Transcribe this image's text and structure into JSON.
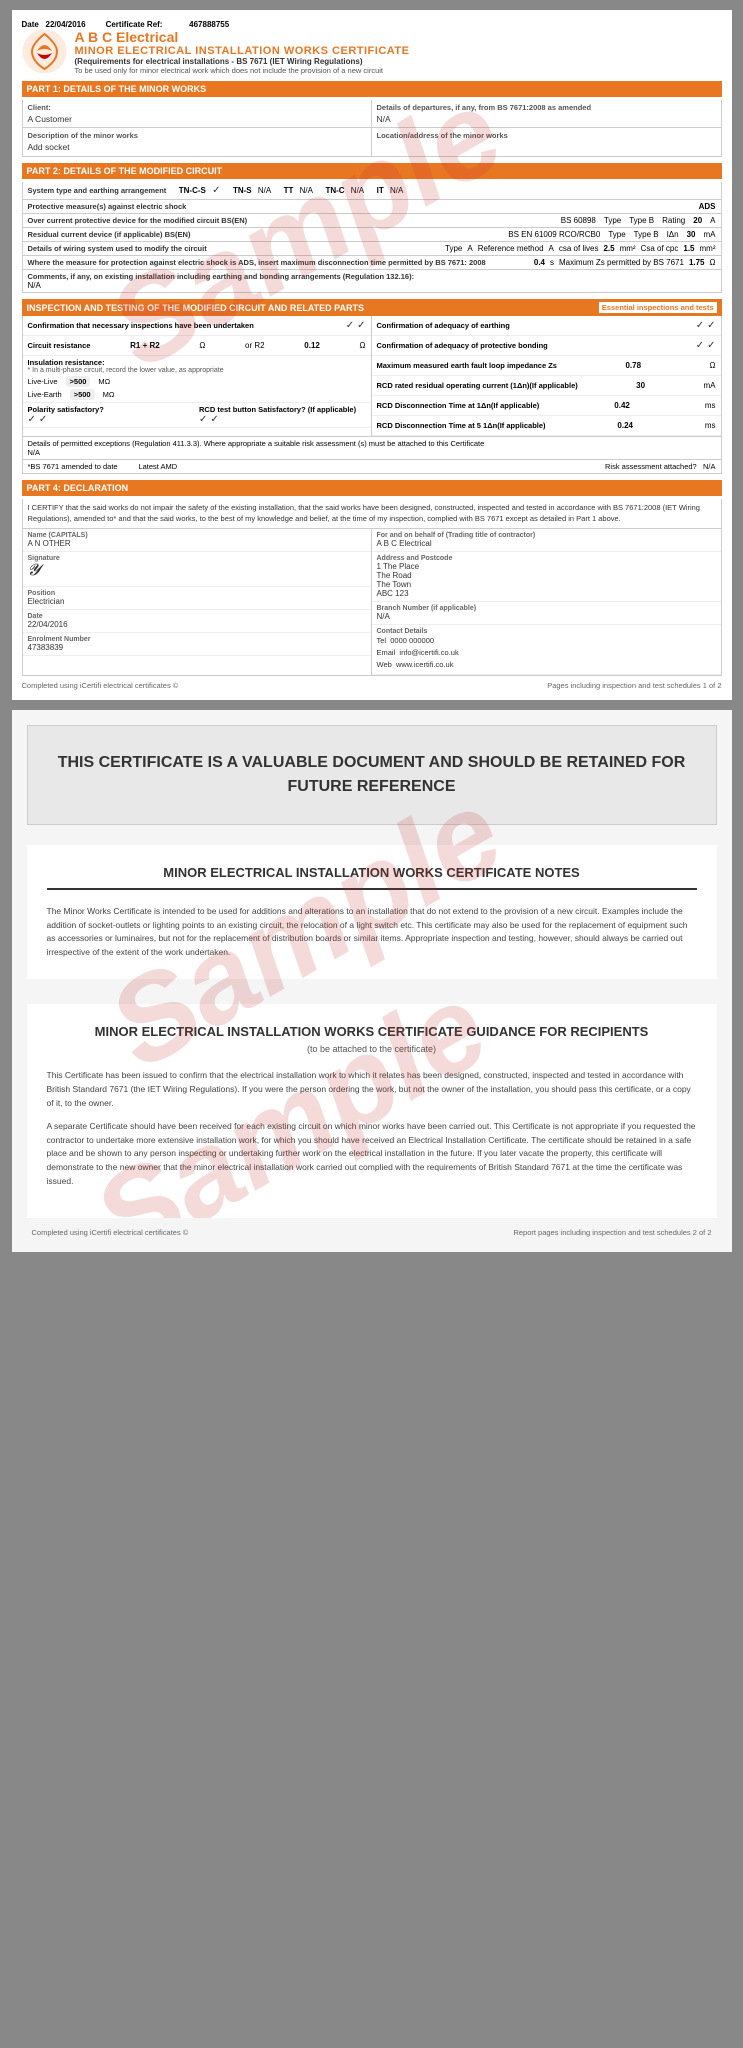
{
  "page1": {
    "header": {
      "date_label": "Date",
      "date_value": "22/04/2016",
      "cert_ref_label": "Certificate Ref:",
      "cert_ref_value": "467888755"
    },
    "company": {
      "name": "A B C Electrical",
      "cert_title": "MINOR ELECTRICAL INSTALLATION WORKS CERTIFICATE",
      "subtitle": "(Requirements for electrical installations - BS 7671 (IET Wiring Regulations)",
      "note": "To be used only for minor electrical work which does not include the provision of a new circuit"
    },
    "part1": {
      "header": "PART 1: DETAILS OF THE MINOR WORKS",
      "client_label": "Client:",
      "client_value": "A Customer",
      "departures_label": "Details of departures, if any, from BS 7671:2008 as amended",
      "departures_value": "N/A",
      "description_label": "Description of the minor works",
      "description_value": "Add socket",
      "location_label": "Location/address of the minor works",
      "location_value": ""
    },
    "part2": {
      "header": "PART 2: DETAILS OF THE MODIFIED CIRCUIT",
      "system_label": "System type and earthing arrangement",
      "system_items": [
        {
          "label": "TN-C-S",
          "checked": true
        },
        {
          "label": "TN-S",
          "value": "N/A"
        },
        {
          "label": "TT",
          "value": "N/A"
        },
        {
          "label": "TN-C",
          "value": "N/A"
        },
        {
          "label": "IT",
          "value": "N/A"
        }
      ],
      "protective_label": "Protective measure(s) against electric shock",
      "protective_value": "ADS",
      "overcurrent_label": "Over current protective device for the modified circuit BS(EN)",
      "overcurrent_standard": "BS 60898",
      "overcurrent_type_label": "Type",
      "overcurrent_type_value": "Type B",
      "overcurrent_rating_label": "Rating",
      "overcurrent_rating_value": "20",
      "overcurrent_unit": "A",
      "rcd_label": "Residual current device (if applicable) BS(EN)",
      "rcd_standard": "BS EN 61009 RCO/RCB0",
      "rcd_type_label": "Type",
      "rcd_type_value": "Type B",
      "rcd_ion_label": "IΔn",
      "rcd_ion_value": "30",
      "rcd_unit": "mA",
      "wiring_label": "Details of wiring system used to modify the circuit",
      "wiring_type_label": "Type",
      "wiring_type_value": "A",
      "wiring_ref_label": "Reference method",
      "wiring_ref_value": "A",
      "wiring_csa_label": "csa of lives",
      "wiring_csa_value": "2.5",
      "wiring_csa_unit": "mm²",
      "wiring_cpc_label": "Csa of cpc",
      "wiring_cpc_value": "1.5",
      "wiring_cpc_unit": "mm²",
      "protection_label": "Where the measure for protection against electric shock is ADS, insert maximum disconnection time permitted by BS 7671: 2008",
      "protection_value": "0.4",
      "protection_unit": "s",
      "max_zs_label": "Maximum Zs permitted by BS 7671",
      "max_zs_value": "1.75",
      "max_zs_unit": "Ω",
      "comments_label": "Comments, if any, on existing installation including earthing and bonding arrangements (Regulation 132.16):",
      "comments_value": "N/A"
    },
    "inspection": {
      "header": "INSPECTION AND TESTING OF THE MODIFIED CIRCUIT AND RELATED PARTS",
      "essential_label": "Essential inspections and tests",
      "inspections_undertaken_label": "Confirmation that necessary inspections have been undertaken",
      "inspections_undertaken_checks": [
        "✓",
        "✓"
      ],
      "earthing_adequacy_label": "Confirmation of adequacy of earthing",
      "earthing_adequacy_checks": [
        "✓",
        "✓"
      ],
      "circuit_resistance_label": "Circuit resistance",
      "circuit_r1r2_label": "R1 + R2",
      "circuit_r1r2_unit": "Ω",
      "circuit_or_r2_label": "or R2",
      "circuit_r2_value": "0.12",
      "circuit_r2_unit": "Ω",
      "bonding_label": "Confirmation of adequacy of protective bonding",
      "bonding_checks": [
        "✓",
        "✓"
      ],
      "insulation_label": "Insulation resistance:",
      "insulation_note": "* In a multi-phase circuit, record the lower value, as appropriate",
      "polarity_label": "Polarity satisfactory?",
      "polarity_checks": [
        "✓",
        "✓"
      ],
      "rcd_test_label": "RCD test button Satisfactory? (If applicable)",
      "rcd_test_checks": [
        "✓",
        "✓"
      ],
      "max_earth_fault_label": "Maximum measured earth fault loop impedance Zs",
      "max_earth_fault_value": "0.78",
      "max_earth_fault_unit": "Ω",
      "rcd_rated_label": "RCD rated residual operating current (1Δn)(If applicable)",
      "rcd_rated_value": "30",
      "rcd_rated_unit": "mA",
      "rcd_time_1_label": "RCD Disconnection Time at 1Δn(If applicable)",
      "rcd_time_1_value": "0.42",
      "rcd_time_1_unit": "ms",
      "live_live_label": "Live-Live",
      "live_live_value": ">500",
      "live_live_unit": "MΩ",
      "rcd_time_5_label": "RCD Disconnection Time at 5 1Δn(If applicable)",
      "rcd_time_5_value": "0.24",
      "rcd_time_5_unit": "ms",
      "live_earth_label": "Live-Earth",
      "live_earth_value": ">500",
      "live_earth_unit": "MΩ",
      "details_note": "Details of permitted exceptions (Regulation 411.3.3). Where appropriate a suitable risk assessment (s) must be attached to this Certificate",
      "details_value": "N/A",
      "bs7671_label": "*BS 7671 amended to date",
      "bs7671_value": "",
      "latest_amd_label": "Latest AMD",
      "risk_label": "Risk assessment attached?",
      "risk_value": "N/A"
    },
    "part4": {
      "header": "PART 4: DECLARATION",
      "declaration_text": "I CERTIFY that the said works do not impair the safety of the existing installation, that the said works have been designed, constructed, inspected and tested in accordance with BS 7671:2008 (IET Wiring Regulations), amended to* and that the said works, to the best of my knowledge and belief, at the time of my inspection, complied with BS 7671 except as detailed in Part 1 above.",
      "name_label": "Name (CAPITALS)",
      "name_value": "A N OTHER",
      "for_behalf_label": "For and on behalf of (Trading title of contractor)",
      "for_behalf_value": "A B C Electrical",
      "signature_label": "Signature",
      "address_label": "Address and Postcode",
      "address_value": "1 The Place\nThe Road\nThe Town\nABC 123",
      "position_label": "Position",
      "position_value": "Electrician",
      "branch_label": "Branch Number (if applicable)",
      "branch_value": "N/A",
      "date_label": "Date",
      "date_value": "22/04/2016",
      "contact_label": "Contact Details",
      "tel_label": "Tel",
      "tel_value": "0000 000000",
      "email_label": "Email",
      "email_value": "info@icertifi.co.uk",
      "web_label": "Web",
      "web_value": "www.icertifi.co.uk",
      "enrolment_label": "Enrolment Number",
      "enrolment_value": "47383839"
    },
    "footer": {
      "left": "Completed using iCertifi electrical certificates ©",
      "right": "Pages including inspection and test schedules 1 of 2"
    }
  },
  "page2": {
    "valuable_text": "THIS CERTIFICATE IS A VALUABLE DOCUMENT AND SHOULD BE RETAINED FOR FUTURE REFERENCE",
    "notes_title": "MINOR ELECTRICAL INSTALLATION WORKS CERTIFICATE NOTES",
    "notes_text": "The Minor Works Certificate is intended to be used for additions and alterations to an installation that do not extend to the provision of a new circuit. Examples include the addition of socket-outlets or lighting points to an existing circuit, the relocation of a light switch etc. This certificate may also be used for the replacement of equipment such as accessories or luminaires, but not for the replacement of distribution boards or similar items. Appropriate inspection and testing, however, should always be carried out irrespective of the extent of the work undertaken.",
    "guidance_title": "MINOR ELECTRICAL INSTALLATION WORKS CERTIFICATE GUIDANCE FOR RECIPIENTS",
    "guidance_subtitle": "(to be attached to the certificate)",
    "guidance_text1": "This Certificate has been issued to confirm that the electrical installation work to which it relates has been designed, constructed, inspected and tested in accordance with British Standard 7671 (the IET Wiring Regulations). If you were the person ordering the work, but not the owner of the installation, you should pass this certificate, or a copy of it, to the owner.",
    "guidance_text2": "A separate Certificate should have been received for each existing circuit on which minor works have been carried out. This Certificate is not appropriate if you requested the contractor to undertake more extensive installation work, for which you should have received an Electrical Installation Certificate. The certificate should be retained in a safe place and be shown to any person inspecting or undertaking further work on the electrical installation in the future. If you later vacate the property, this certificate will demonstrate to the new owner that the minor electrical installation work carried out complied with the requirements of British Standard 7671 at the time the certificate was issued.",
    "footer_left": "Completed using iCertifi electrical certificates ©",
    "footer_right": "Report pages including inspection and test schedules 2 of 2"
  }
}
